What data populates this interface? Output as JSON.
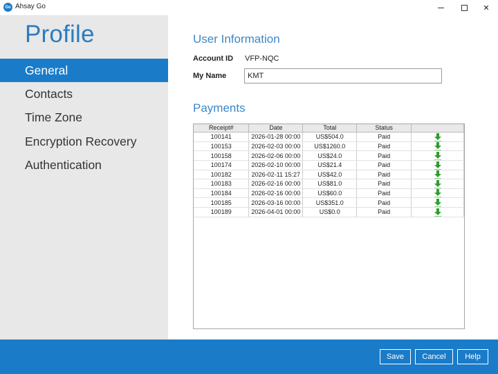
{
  "window": {
    "title": "Ahsay Go",
    "icon_text": "Go",
    "close_glyph": "✕"
  },
  "sidebar": {
    "title": "Profile",
    "items": [
      {
        "label": "General",
        "active": true
      },
      {
        "label": "Contacts",
        "active": false
      },
      {
        "label": "Time Zone",
        "active": false
      },
      {
        "label": "Encryption Recovery",
        "active": false
      },
      {
        "label": "Authentication",
        "active": false
      }
    ]
  },
  "user_info": {
    "heading": "User Information",
    "account_id_label": "Account ID",
    "account_id_value": "VFP-NQC",
    "my_name_label": "My Name",
    "my_name_value": "KMT"
  },
  "payments": {
    "heading": "Payments",
    "columns": [
      "Receipt#",
      "Date",
      "Total",
      "Status",
      ""
    ],
    "rows": [
      {
        "receipt": "100141",
        "date": "2026-01-28 00:00",
        "total": "US$504.0",
        "status": "Paid"
      },
      {
        "receipt": "100153",
        "date": "2026-02-03 00:00",
        "total": "US$1260.0",
        "status": "Paid"
      },
      {
        "receipt": "100158",
        "date": "2026-02-06 00:00",
        "total": "US$24.0",
        "status": "Paid"
      },
      {
        "receipt": "100174",
        "date": "2026-02-10 00:00",
        "total": "US$21.4",
        "status": "Paid"
      },
      {
        "receipt": "100182",
        "date": "2026-02-11 15:27",
        "total": "US$42.0",
        "status": "Paid"
      },
      {
        "receipt": "100183",
        "date": "2026-02-16 00:00",
        "total": "US$81.0",
        "status": "Paid"
      },
      {
        "receipt": "100184",
        "date": "2026-02-16 00:00",
        "total": "US$60.0",
        "status": "Paid"
      },
      {
        "receipt": "100185",
        "date": "2026-03-16 00:00",
        "total": "US$351.0",
        "status": "Paid"
      },
      {
        "receipt": "100189",
        "date": "2026-04-01 00:00",
        "total": "US$0.0",
        "status": "Paid"
      }
    ],
    "download_icon": "download-arrow-icon"
  },
  "footer": {
    "save_label": "Save",
    "cancel_label": "Cancel",
    "help_label": "Help"
  },
  "colors": {
    "accent": "#1a7cc9",
    "sidebar_bg": "#e8e8e8",
    "heading": "#3c87c8",
    "download_green": "#2e9e2e"
  }
}
